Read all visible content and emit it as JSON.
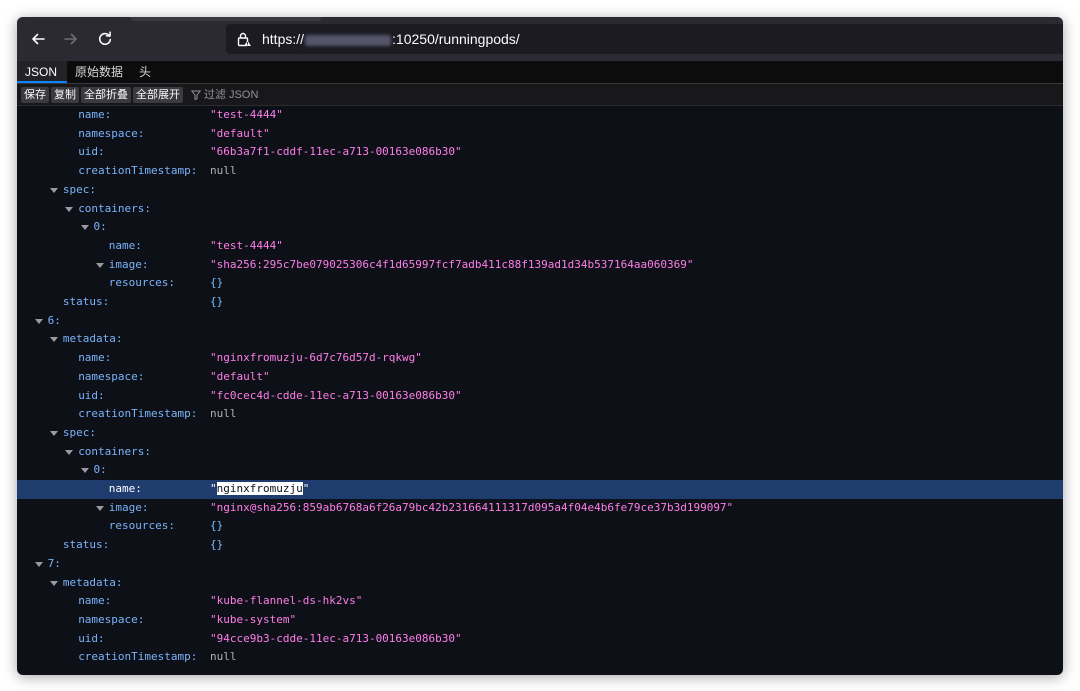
{
  "browser": {
    "url_prefix": "https://",
    "url_suffix": ":10250/runningpods/"
  },
  "view_tabs": [
    {
      "label": "JSON",
      "active": true
    },
    {
      "label": "原始数据",
      "active": false
    },
    {
      "label": "头",
      "active": false
    }
  ],
  "toolbar": {
    "save": "保存",
    "copy": "复制",
    "collapse_all": "全部折叠",
    "expand_all": "全部展开",
    "filter_placeholder": "过滤 JSON"
  },
  "rows": [
    {
      "depth": 3,
      "key": "name:",
      "value": "\"test-4444\"",
      "type": "string"
    },
    {
      "depth": 3,
      "key": "namespace:",
      "value": "\"default\"",
      "type": "string"
    },
    {
      "depth": 3,
      "key": "uid:",
      "value": "\"66b3a7f1-cddf-11ec-a713-00163e086b30\"",
      "type": "string"
    },
    {
      "depth": 3,
      "key": "creationTimestamp:",
      "value": "null",
      "type": "null"
    },
    {
      "depth": 2,
      "key": "spec:",
      "toggle": true
    },
    {
      "depth": 3,
      "key": "containers:",
      "toggle": true
    },
    {
      "depth": 4,
      "key": "0:",
      "toggle": true
    },
    {
      "depth": 5,
      "key": "name:",
      "value": "\"test-4444\"",
      "type": "string"
    },
    {
      "depth": 5,
      "key": "image:",
      "toggle": true,
      "value": "\"sha256:295c7be079025306c4f1d65997fcf7adb411c88f139ad1d34b537164aa060369\"",
      "type": "string"
    },
    {
      "depth": 5,
      "key": "resources:",
      "value": "{}",
      "type": "obj"
    },
    {
      "depth": 2,
      "key": "status:",
      "value": "{}",
      "type": "obj"
    },
    {
      "depth": 1,
      "key": "6:",
      "toggle": true
    },
    {
      "depth": 2,
      "key": "metadata:",
      "toggle": true
    },
    {
      "depth": 3,
      "key": "name:",
      "value": "\"nginxfromuzju-6d7c76d57d-rqkwg\"",
      "type": "string"
    },
    {
      "depth": 3,
      "key": "namespace:",
      "value": "\"default\"",
      "type": "string"
    },
    {
      "depth": 3,
      "key": "uid:",
      "value": "\"fc0cec4d-cdde-11ec-a713-00163e086b30\"",
      "type": "string"
    },
    {
      "depth": 3,
      "key": "creationTimestamp:",
      "value": "null",
      "type": "null"
    },
    {
      "depth": 2,
      "key": "spec:",
      "toggle": true
    },
    {
      "depth": 3,
      "key": "containers:",
      "toggle": true
    },
    {
      "depth": 4,
      "key": "0:",
      "toggle": true
    },
    {
      "depth": 5,
      "key": "name:",
      "value": "\"nginxfromuzju\"",
      "type": "string",
      "selected": true,
      "highlight": "nginxfromuzju"
    },
    {
      "depth": 5,
      "key": "image:",
      "toggle": true,
      "value": "\"nginx@sha256:859ab6768a6f26a79bc42b231664111317d095a4f04e4b6fe79ce37b3d199097\"",
      "type": "string"
    },
    {
      "depth": 5,
      "key": "resources:",
      "value": "{}",
      "type": "obj"
    },
    {
      "depth": 2,
      "key": "status:",
      "value": "{}",
      "type": "obj"
    },
    {
      "depth": 1,
      "key": "7:",
      "toggle": true
    },
    {
      "depth": 2,
      "key": "metadata:",
      "toggle": true
    },
    {
      "depth": 3,
      "key": "name:",
      "value": "\"kube-flannel-ds-hk2vs\"",
      "type": "string"
    },
    {
      "depth": 3,
      "key": "namespace:",
      "value": "\"kube-system\"",
      "type": "string"
    },
    {
      "depth": 3,
      "key": "uid:",
      "value": "\"94cce9b3-cdde-11ec-a713-00163e086b30\"",
      "type": "string"
    },
    {
      "depth": 3,
      "key": "creationTimestamp:",
      "value": "null",
      "type": "null"
    }
  ]
}
